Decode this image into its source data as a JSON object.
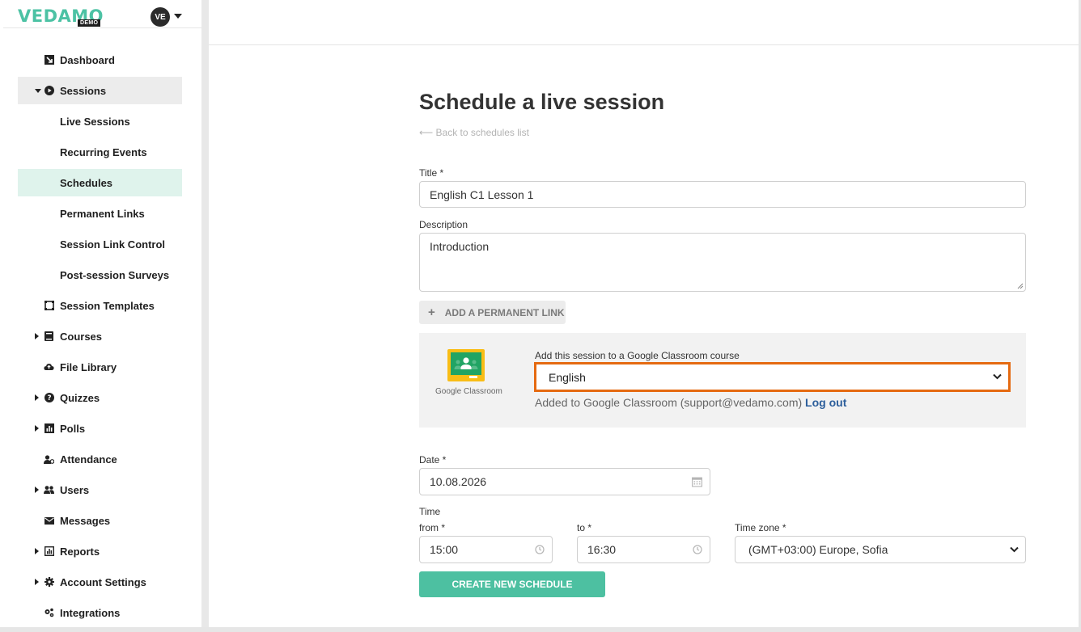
{
  "brand": {
    "name": "VEDAMO",
    "badge": "DEMO"
  },
  "user": {
    "initials": "VE"
  },
  "sidebar": {
    "items": [
      {
        "label": "Dashboard",
        "icon": "dashboard-icon"
      },
      {
        "label": "Sessions",
        "icon": "play-circle-icon",
        "expanded": true
      },
      {
        "label": "Live Sessions"
      },
      {
        "label": "Recurring Events"
      },
      {
        "label": "Schedules",
        "active": true
      },
      {
        "label": "Permanent Links"
      },
      {
        "label": "Session Link Control"
      },
      {
        "label": "Post-session Surveys"
      },
      {
        "label": "Session Templates",
        "icon": "template-icon"
      },
      {
        "label": "Courses",
        "icon": "book-icon"
      },
      {
        "label": "File Library",
        "icon": "cloud-icon"
      },
      {
        "label": "Quizzes",
        "icon": "question-icon"
      },
      {
        "label": "Polls",
        "icon": "bar-chart-icon"
      },
      {
        "label": "Attendance",
        "icon": "user-check-icon"
      },
      {
        "label": "Users",
        "icon": "users-icon"
      },
      {
        "label": "Messages",
        "icon": "envelope-icon"
      },
      {
        "label": "Reports",
        "icon": "report-icon"
      },
      {
        "label": "Account Settings",
        "icon": "gear-icon"
      },
      {
        "label": "Integrations",
        "icon": "gears-icon"
      }
    ]
  },
  "page": {
    "title": "Schedule a live session",
    "back_link": "⟵ Back to schedules list"
  },
  "form": {
    "title_label": "Title *",
    "title_value": "English C1 Lesson 1",
    "description_label": "Description",
    "description_value": "Introduction",
    "permanent_link_button": "ADD A PERMANENT LINK",
    "google_classroom": {
      "logo_text": "Google Classroom",
      "label": "Add this session to a Google Classroom course",
      "selected": "English",
      "status": "Added to Google Classroom (support@vedamo.com)",
      "logout": "Log out"
    },
    "date_label": "Date *",
    "date_value": "10.08.2026",
    "time_label": "Time",
    "from_label": "from *",
    "from_value": "15:00",
    "to_label": "to *",
    "to_value": "16:30",
    "timezone_label": "Time zone *",
    "timezone_value": "(GMT+03:00) Europe, Sofia",
    "submit_button": "CREATE NEW SCHEDULE"
  },
  "colors": {
    "accent": "#4dc0a1",
    "highlight": "#e56a11",
    "link": "#2c5e9b"
  }
}
